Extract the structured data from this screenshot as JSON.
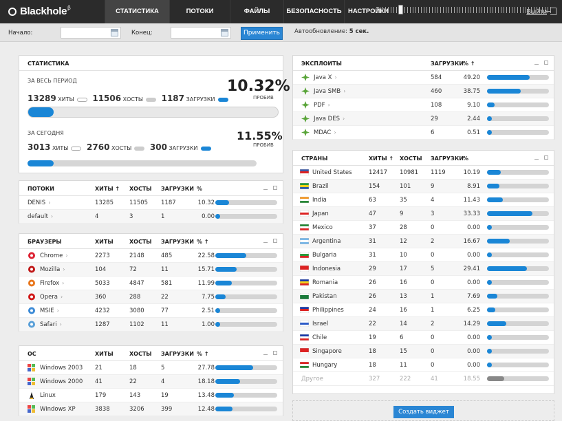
{
  "app": {
    "name": "Blackhole",
    "beta": "β"
  },
  "nav": {
    "tabs": [
      "СТАТИСТИКА",
      "ПОТОКИ",
      "ФАЙЛЫ",
      "БЕЗОПАСНОСТЬ",
      "НАСТРОЙКИ"
    ],
    "active": 0,
    "logout": "Выйти"
  },
  "filter": {
    "start_label": "Начало:",
    "end_label": "Конец:",
    "apply": "Применить",
    "auto_label": "Автообновление:",
    "auto_value": "5 сек.",
    "auto_slider_fraction": 0.12
  },
  "stats": {
    "title": "СТАТИСТИКА",
    "all": {
      "label": "ЗА ВЕСЬ ПЕРИОД",
      "hits": "13289",
      "hits_l": "ХИТЫ",
      "hosts": "11506",
      "hosts_l": "ХОСТЫ",
      "loads": "1187",
      "loads_l": "ЗАГРУЗКИ",
      "pct": "10.32%",
      "pct_l": "ПРОБИВ",
      "fill": 0.1032
    },
    "today": {
      "label": "ЗА СЕГОДНЯ",
      "hits": "3013",
      "hits_l": "ХИТЫ",
      "hosts": "2760",
      "hosts_l": "ХОСТЫ",
      "loads": "300",
      "loads_l": "ЗАГРУЗКИ",
      "pct": "11.55%",
      "pct_l": "ПРОБИВ",
      "fill": 0.1155
    }
  },
  "streams": {
    "title": "ПОТОКИ",
    "cols": [
      "ХИТЫ ↑",
      "ХОСТЫ",
      "ЗАГРУЗКИ",
      "%"
    ],
    "rows": [
      {
        "name": "DENIS",
        "gt": "›",
        "hits": "13285",
        "hosts": "11505",
        "loads": "1187",
        "pct": "10.32",
        "v": 0.1032
      },
      {
        "name": "default",
        "gt": "›",
        "hits": "4",
        "hosts": "3",
        "loads": "1",
        "pct": "0.00",
        "v": 0
      }
    ]
  },
  "browsers": {
    "title": "БРАУЗЕРЫ",
    "cols": [
      "ХИТЫ",
      "ХОСТЫ",
      "ЗАГРУЗКИ",
      "% ↑"
    ],
    "rows": [
      {
        "name": "Chrome",
        "gt": "›",
        "icon": "chrome-icon",
        "color": "#d23",
        "hits": "2273",
        "hosts": "2148",
        "loads": "485",
        "pct": "22.58",
        "v": 0.2258
      },
      {
        "name": "Mozilla",
        "gt": "›",
        "icon": "mozilla-icon",
        "color": "#c01818",
        "hits": "104",
        "hosts": "72",
        "loads": "11",
        "pct": "15.71",
        "v": 0.1571
      },
      {
        "name": "Firefox",
        "gt": "›",
        "icon": "firefox-icon",
        "color": "#e8761c",
        "hits": "5033",
        "hosts": "4847",
        "loads": "581",
        "pct": "11.99",
        "v": 0.1199
      },
      {
        "name": "Opera",
        "gt": "›",
        "icon": "opera-icon",
        "color": "#d01818",
        "hits": "360",
        "hosts": "288",
        "loads": "22",
        "pct": "7.75",
        "v": 0.0775
      },
      {
        "name": "MSIE",
        "gt": "›",
        "icon": "msie-icon",
        "color": "#3b8ad6",
        "hits": "4232",
        "hosts": "3080",
        "loads": "77",
        "pct": "2.51",
        "v": 0.0251
      },
      {
        "name": "Safari",
        "gt": "›",
        "icon": "safari-icon",
        "color": "#5aa0d8",
        "hits": "1287",
        "hosts": "1102",
        "loads": "11",
        "pct": "1.00",
        "v": 0.01
      }
    ]
  },
  "os": {
    "title": "ОС",
    "cols": [
      "ХИТЫ",
      "ХОСТЫ",
      "ЗАГРУЗКИ",
      "% ↑"
    ],
    "rows": [
      {
        "name": "Windows 2003",
        "icon": "windows-icon",
        "hits": "21",
        "hosts": "18",
        "loads": "5",
        "pct": "27.78",
        "v": 0.2778
      },
      {
        "name": "Windows 2000",
        "icon": "windows-icon",
        "hits": "41",
        "hosts": "22",
        "loads": "4",
        "pct": "18.18",
        "v": 0.1818
      },
      {
        "name": "Linux",
        "icon": "linux-icon",
        "hits": "179",
        "hosts": "143",
        "loads": "19",
        "pct": "13.48",
        "v": 0.1348
      },
      {
        "name": "Windows XP",
        "icon": "windows-icon",
        "hits": "3838",
        "hosts": "3206",
        "loads": "399",
        "pct": "12.48",
        "v": 0.1248
      }
    ]
  },
  "exploits": {
    "title": "ЭКСПЛОИТЫ",
    "cols": [
      "ЗАГРУЗКИ",
      "% ↑"
    ],
    "rows": [
      {
        "name": "Java X",
        "gt": "›",
        "loads": "584",
        "pct": "49.20",
        "v": 0.492
      },
      {
        "name": "Java SMB",
        "gt": "›",
        "loads": "460",
        "pct": "38.75",
        "v": 0.3875
      },
      {
        "name": "PDF",
        "gt": "›",
        "loads": "108",
        "pct": "9.10",
        "v": 0.091
      },
      {
        "name": "Java DES",
        "gt": "›",
        "loads": "29",
        "pct": "2.44",
        "v": 0.0244
      },
      {
        "name": "MDAC",
        "gt": "›",
        "loads": "6",
        "pct": "0.51",
        "v": 0.0051
      }
    ]
  },
  "countries": {
    "title": "СТРАНЫ",
    "cols": [
      "ХИТЫ ↑",
      "ХОСТЫ",
      "ЗАГРУЗКИ",
      "%"
    ],
    "rows": [
      {
        "name": "United States",
        "flag": [
          "#3c5ba8",
          "#d22",
          "#fff"
        ],
        "hits": "12417",
        "hosts": "10981",
        "loads": "1119",
        "pct": "10.19",
        "v": 0.1019
      },
      {
        "name": "Brazil",
        "flag": [
          "#2a9a3a",
          "#f3d21a",
          "#2a5aa8"
        ],
        "hits": "154",
        "hosts": "101",
        "loads": "9",
        "pct": "8.91",
        "v": 0.0891
      },
      {
        "name": "India",
        "flag": [
          "#f39a2a",
          "#fff",
          "#2a8a3a"
        ],
        "hits": "63",
        "hosts": "35",
        "loads": "4",
        "pct": "11.43",
        "v": 0.1143
      },
      {
        "name": "Japan",
        "flag": [
          "#fff",
          "#d22",
          "#fff"
        ],
        "hits": "47",
        "hosts": "9",
        "loads": "3",
        "pct": "33.33",
        "v": 0.3333
      },
      {
        "name": "Mexico",
        "flag": [
          "#2a8a3a",
          "#fff",
          "#d22"
        ],
        "hits": "37",
        "hosts": "28",
        "loads": "0",
        "pct": "0.00",
        "v": 0
      },
      {
        "name": "Argentina",
        "flag": [
          "#7ab8e8",
          "#fff",
          "#7ab8e8"
        ],
        "hits": "31",
        "hosts": "12",
        "loads": "2",
        "pct": "16.67",
        "v": 0.1667
      },
      {
        "name": "Bulgaria",
        "flag": [
          "#fff",
          "#2a9a3a",
          "#d22"
        ],
        "hits": "31",
        "hosts": "10",
        "loads": "0",
        "pct": "0.00",
        "v": 0
      },
      {
        "name": "Indonesia",
        "flag": [
          "#d22",
          "#d22",
          "#fff"
        ],
        "hits": "29",
        "hosts": "17",
        "loads": "5",
        "pct": "29.41",
        "v": 0.2941
      },
      {
        "name": "Romania",
        "flag": [
          "#1a3aa8",
          "#f3d21a",
          "#d22"
        ],
        "hits": "26",
        "hosts": "16",
        "loads": "0",
        "pct": "0.00",
        "v": 0
      },
      {
        "name": "Pakistan",
        "flag": [
          "#fff",
          "#1a7a3a",
          "#1a7a3a"
        ],
        "hits": "26",
        "hosts": "13",
        "loads": "1",
        "pct": "7.69",
        "v": 0.0769
      },
      {
        "name": "Philippines",
        "flag": [
          "#1a3aa8",
          "#d22",
          "#fff"
        ],
        "hits": "24",
        "hosts": "16",
        "loads": "1",
        "pct": "6.25",
        "v": 0.0625
      },
      {
        "name": "Israel",
        "flag": [
          "#fff",
          "#2a5ac8",
          "#fff"
        ],
        "hits": "22",
        "hosts": "14",
        "loads": "2",
        "pct": "14.29",
        "v": 0.1429
      },
      {
        "name": "Chile",
        "flag": [
          "#1a3aa8",
          "#fff",
          "#d22"
        ],
        "hits": "19",
        "hosts": "6",
        "loads": "0",
        "pct": "0.00",
        "v": 0
      },
      {
        "name": "Singapore",
        "flag": [
          "#d22",
          "#d22",
          "#fff"
        ],
        "hits": "18",
        "hosts": "15",
        "loads": "0",
        "pct": "0.00",
        "v": 0
      },
      {
        "name": "Hungary",
        "flag": [
          "#d22",
          "#fff",
          "#2a8a3a"
        ],
        "hits": "18",
        "hosts": "11",
        "loads": "0",
        "pct": "0.00",
        "v": 0
      }
    ],
    "other": {
      "name": "Другое",
      "hits": "327",
      "hosts": "222",
      "loads": "41",
      "pct": "18.55",
      "v": 0.1855
    }
  },
  "create_widget": "Создать виджет",
  "colors": {
    "accent": "#1a86d6",
    "bar_bg": "#d4d4d4",
    "topbar": "#2b2b2b",
    "exploit_icon": "#5aa53a"
  }
}
